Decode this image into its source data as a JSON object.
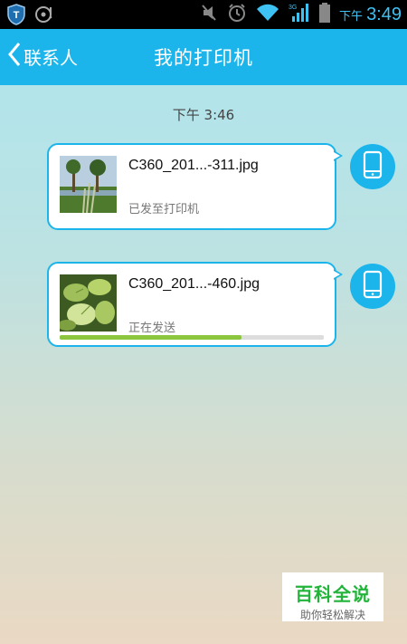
{
  "status_bar": {
    "ampm": "下午",
    "time": "3:49",
    "icons": [
      "shield-app-icon",
      "media-icon",
      "mute-icon",
      "alarm-icon",
      "wifi-icon",
      "signal-3g-icon",
      "battery-icon"
    ]
  },
  "header": {
    "back_label": "联系人",
    "title": "我的打印机"
  },
  "conversation": {
    "timestamp": "下午 3:46",
    "messages": [
      {
        "filename": "C360_201...-311.jpg",
        "status": "已发至打印机",
        "progress": null,
        "thumb": "trees-photo"
      },
      {
        "filename": "C360_201...-460.jpg",
        "status": "正在发送",
        "progress": 0.69,
        "thumb": "leaves-photo"
      }
    ]
  },
  "watermark": {
    "main": "百科全说",
    "sub": "助你轻松解决"
  },
  "colors": {
    "accent": "#1bb5ec",
    "progress": "#8cc63f",
    "watermark_green": "#22b43a"
  }
}
